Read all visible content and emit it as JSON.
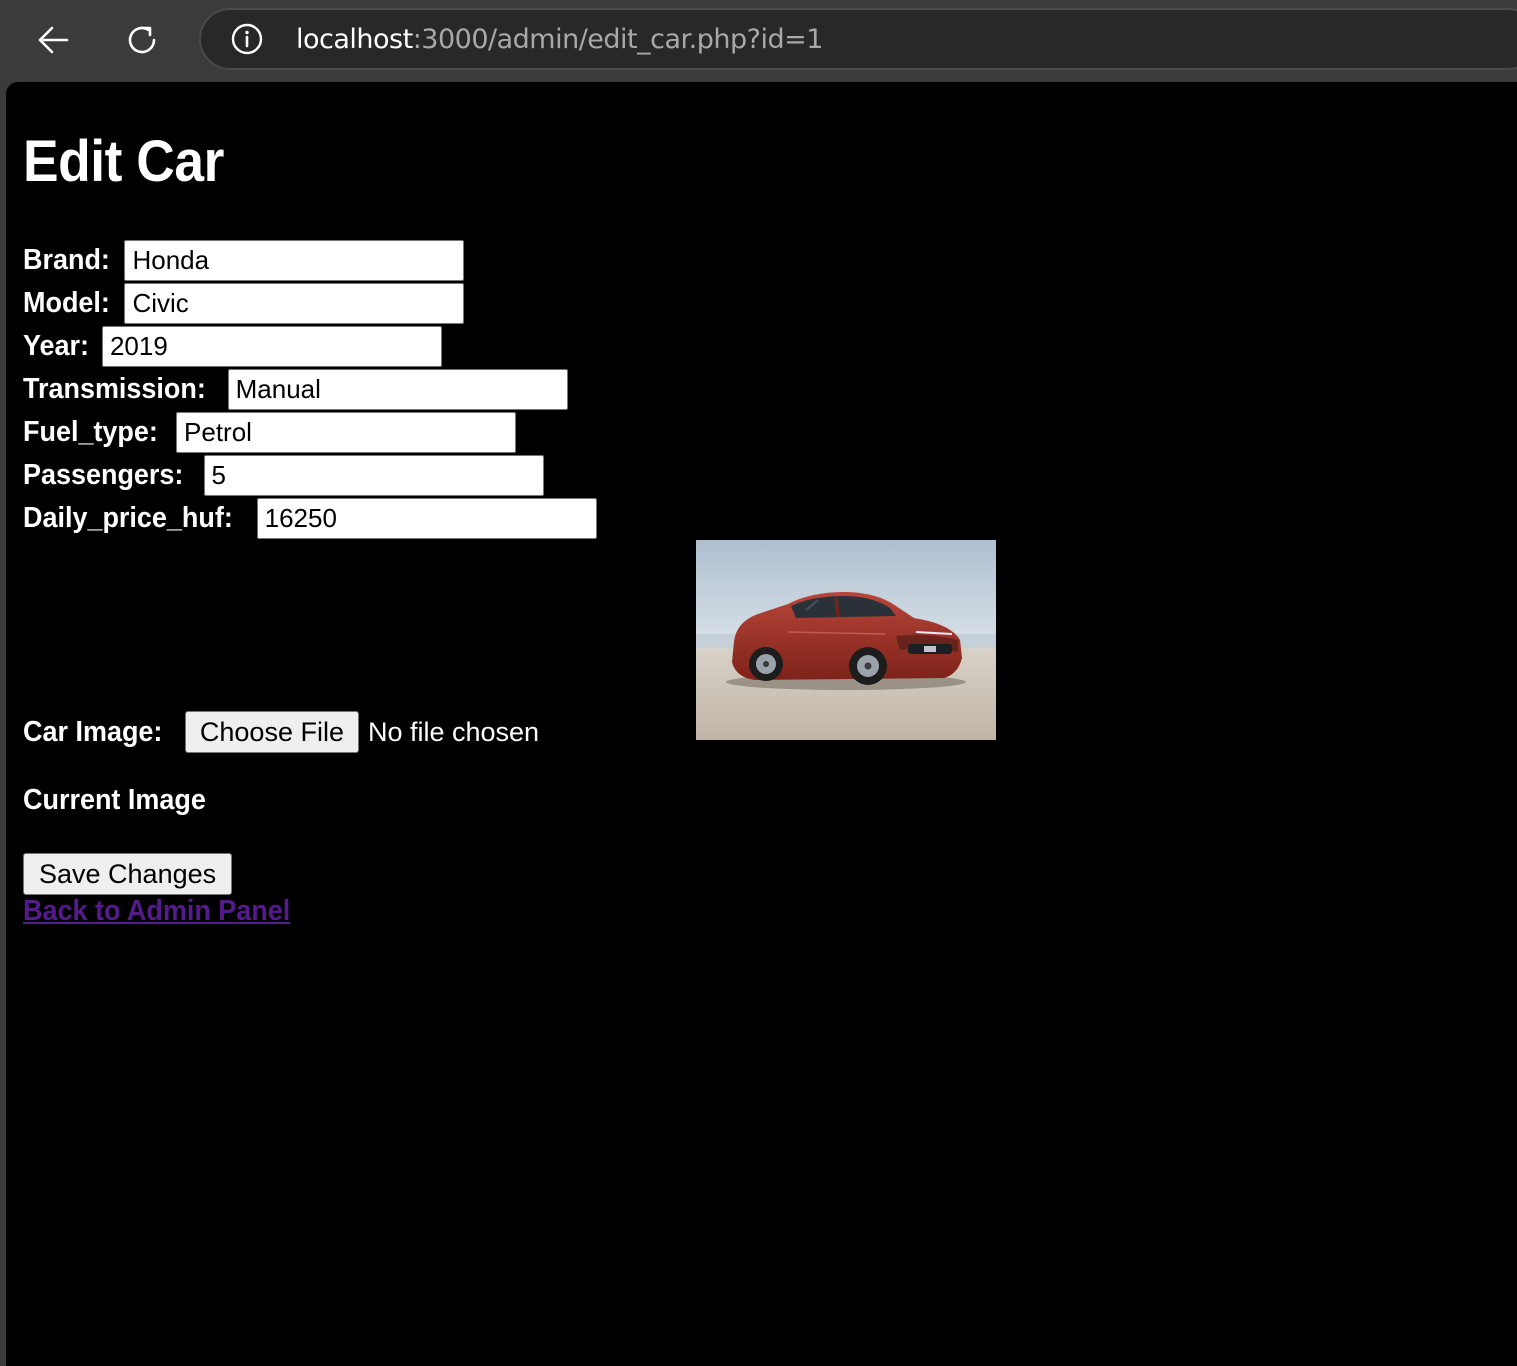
{
  "browser": {
    "url_host": "localhost",
    "url_rest": ":3000/admin/edit_car.php?id=1"
  },
  "page": {
    "title": "Edit Car"
  },
  "form": {
    "fields": [
      {
        "label": "Brand:",
        "value": "Honda"
      },
      {
        "label": "Model:",
        "value": "Civic"
      },
      {
        "label": "Year:",
        "value": "2019"
      },
      {
        "label": "Transmission:",
        "value": "Manual"
      },
      {
        "label": "Fuel_type:",
        "value": "Petrol"
      },
      {
        "label": "Passengers:",
        "value": "5"
      },
      {
        "label": "Daily_price_huf:",
        "value": "16250"
      }
    ],
    "image_label": "Car Image:",
    "choose_file_label": "Choose File",
    "no_file_text": "No file chosen",
    "current_image_label": "Current Image",
    "save_label": "Save Changes",
    "back_link_label": "Back to Admin Panel"
  },
  "colors": {
    "page_background": "#000000",
    "link_visited": "#551a8b",
    "car_body": "#a3382c"
  },
  "icons": {
    "back": "arrow-left-icon",
    "reload": "reload-icon",
    "site_info": "info-icon"
  }
}
